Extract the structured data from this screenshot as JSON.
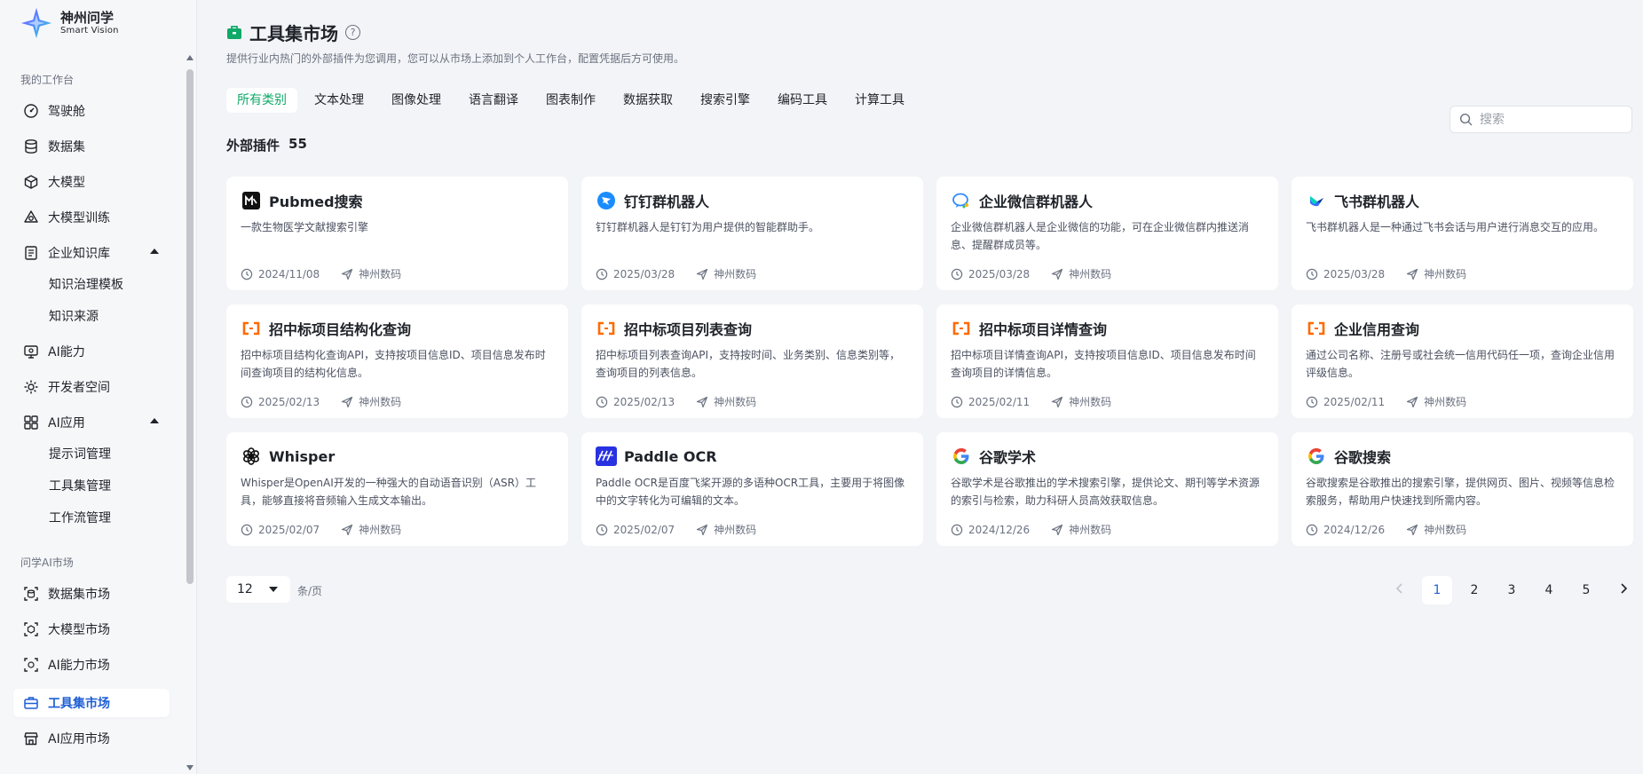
{
  "brand": {
    "name": "神州问学",
    "subname": "Smart Vision"
  },
  "sidebar": {
    "section_workspace": "我的工作台",
    "section_market": "问学AI市场",
    "items": [
      {
        "label": "驾驶舱",
        "icon": "dashboard-icon"
      },
      {
        "label": "数据集",
        "icon": "database-icon"
      },
      {
        "label": "大模型",
        "icon": "cube-icon"
      },
      {
        "label": "大模型训练",
        "icon": "training-icon"
      },
      {
        "label": "企业知识库",
        "icon": "knowledge-icon",
        "expanded": true
      },
      {
        "label": "AI能力",
        "icon": "ai-ability-icon"
      },
      {
        "label": "开发者空间",
        "icon": "developer-icon"
      },
      {
        "label": "AI应用",
        "icon": "apps-grid-icon",
        "expanded": true
      }
    ],
    "knowledge_sub": [
      "知识治理模板",
      "知识来源"
    ],
    "ai_app_sub": [
      "提示词管理",
      "工具集管理",
      "工作流管理"
    ],
    "market_items": [
      {
        "label": "数据集市场",
        "icon": "dataset-market-icon"
      },
      {
        "label": "大模型市场",
        "icon": "model-market-icon"
      },
      {
        "label": "AI能力市场",
        "icon": "ability-market-icon"
      },
      {
        "label": "工具集市场",
        "icon": "toolbox-icon",
        "active": true
      },
      {
        "label": "AI应用市场",
        "icon": "store-icon"
      }
    ]
  },
  "header": {
    "title": "工具集市场",
    "help": "?",
    "description": "提供行业内热门的外部插件为您调用，您可以从市场上添加到个人工作台，配置凭据后方可使用。"
  },
  "tabs": [
    "所有类别",
    "文本处理",
    "图像处理",
    "语言翻译",
    "图表制作",
    "数据获取",
    "搜索引擎",
    "编码工具",
    "计算工具"
  ],
  "active_tab": "所有类别",
  "search": {
    "placeholder": "搜索"
  },
  "plugins": {
    "label": "外部插件",
    "count": "55"
  },
  "cards": [
    {
      "name": "Pubmed搜索",
      "desc": "一款生物医学文献搜索引擎",
      "date": "2024/11/08",
      "publisher": "神州数码",
      "icon": "pubmed-icon"
    },
    {
      "name": "钉钉群机器人",
      "desc": "钉钉群机器人是钉钉为用户提供的智能群助手。",
      "date": "2025/03/28",
      "publisher": "神州数码",
      "icon": "dingtalk-icon"
    },
    {
      "name": "企业微信群机器人",
      "desc": "企业微信群机器人是企业微信的功能，可在企业微信群内推送消息、提醒群成员等。",
      "date": "2025/03/28",
      "publisher": "神州数码",
      "icon": "wecom-icon"
    },
    {
      "name": "飞书群机器人",
      "desc": "飞书群机器人是一种通过飞书会话与用户进行消息交互的应用。",
      "date": "2025/03/28",
      "publisher": "神州数码",
      "icon": "feishu-icon"
    },
    {
      "name": "招中标项目结构化查询",
      "desc": "招中标项目结构化查询API，支持按项目信息ID、项目信息发布时间查询项目的结构化信息。",
      "date": "2025/02/13",
      "publisher": "神州数码",
      "icon": "bracket-api-icon"
    },
    {
      "name": "招中标项目列表查询",
      "desc": "招中标项目列表查询API，支持按时间、业务类别、信息类别等，查询项目的列表信息。",
      "date": "2025/02/13",
      "publisher": "神州数码",
      "icon": "bracket-api-icon"
    },
    {
      "name": "招中标项目详情查询",
      "desc": "招中标项目详情查询API，支持按项目信息ID、项目信息发布时间查询项目的详情信息。",
      "date": "2025/02/11",
      "publisher": "神州数码",
      "icon": "bracket-api-icon"
    },
    {
      "name": "企业信用查询",
      "desc": "通过公司名称、注册号或社会统一信用代码任一项，查询企业信用评级信息。",
      "date": "2025/02/11",
      "publisher": "神州数码",
      "icon": "bracket-api-icon"
    },
    {
      "name": "Whisper",
      "desc": "Whisper是OpenAI开发的一种强大的自动语音识别（ASR）工具，能够直接将音频输入生成文本输出。",
      "date": "2025/02/07",
      "publisher": "神州数码",
      "icon": "openai-icon"
    },
    {
      "name": "Paddle OCR",
      "desc": "Paddle OCR是百度飞桨开源的多语种OCR工具，主要用于将图像中的文字转化为可编辑的文本。",
      "date": "2025/02/07",
      "publisher": "神州数码",
      "icon": "paddle-icon"
    },
    {
      "name": "谷歌学术",
      "desc": "谷歌学术是谷歌推出的学术搜索引擎，提供论文、期刊等学术资源的索引与检索，助力科研人员高效获取信息。",
      "date": "2024/12/26",
      "publisher": "神州数码",
      "icon": "google-icon"
    },
    {
      "name": "谷歌搜索",
      "desc": "谷歌搜索是谷歌推出的搜索引擎，提供网页、图片、视频等信息检索服务，帮助用户快速找到所需内容。",
      "date": "2024/12/26",
      "publisher": "神州数码",
      "icon": "google-icon"
    }
  ],
  "pagination": {
    "page_size": "12",
    "per_page_label": "条/页",
    "pages": [
      "1",
      "2",
      "3",
      "4",
      "5"
    ],
    "current": "1"
  },
  "colors": {
    "accent_green": "#0fa968",
    "active_blue": "#1f5fd6",
    "bracket_orange": "#ff6a00"
  }
}
